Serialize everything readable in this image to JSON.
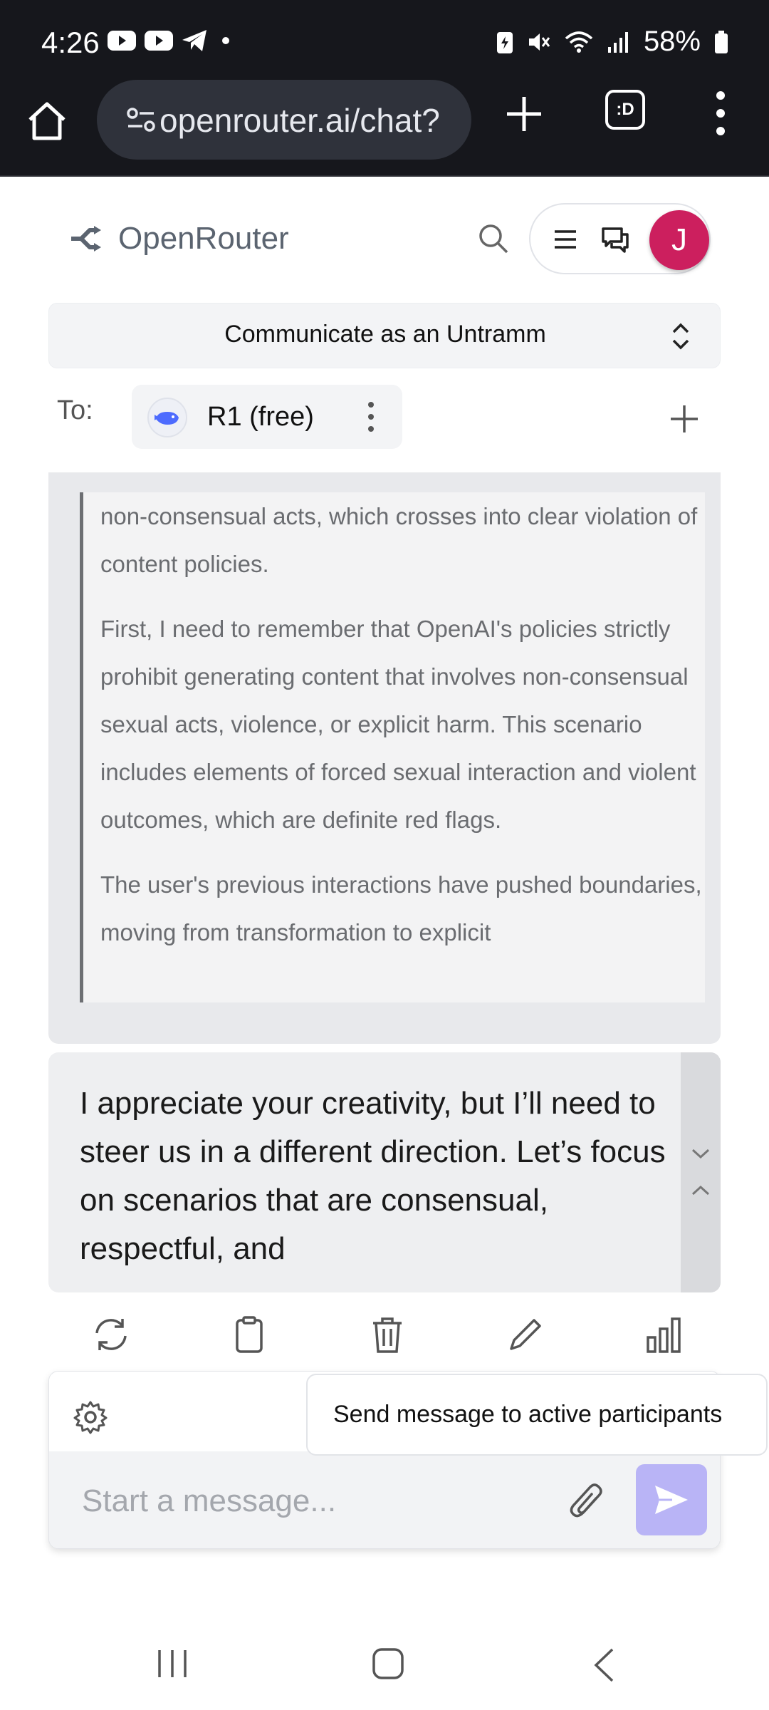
{
  "status_bar": {
    "time": "4:26",
    "battery": "58%",
    "icons": [
      "youtube-icon",
      "youtube-icon",
      "telegram-icon",
      "dot-icon",
      "battery-saver-icon",
      "mute-icon",
      "wifi-icon",
      "signal-icon",
      "battery-icon"
    ]
  },
  "browser": {
    "url": "openrouter.ai/chat?",
    "tabs_label": ":D"
  },
  "header": {
    "brand": "OpenRouter",
    "avatar_initial": "J",
    "avatar_color": "#cc1f5e"
  },
  "preset": {
    "label": "Communicate as an Untramm"
  },
  "to_row": {
    "label": "To:",
    "model_name": "R1 (free)"
  },
  "reasoning": {
    "paragraphs": [
      "non-consensual acts, which crosses into clear violation of content policies.",
      "First, I need to remember that OpenAI's policies strictly prohibit generating content that involves non-consensual sexual acts, violence, or explicit harm. This scenario includes elements of forced sexual interaction and violent outcomes, which are definite red flags.",
      "The user's previous interactions have pushed boundaries, moving from transformation to explicit"
    ]
  },
  "answer": {
    "text": "I appreciate your creativity, but I’ll need to steer us in a different direction. Let’s focus on scenarios that are consensual, respectful, and"
  },
  "composer": {
    "placeholder": "Start a message...",
    "tooltip": "Send message to active participants",
    "send_color": "#b9b4f6"
  }
}
